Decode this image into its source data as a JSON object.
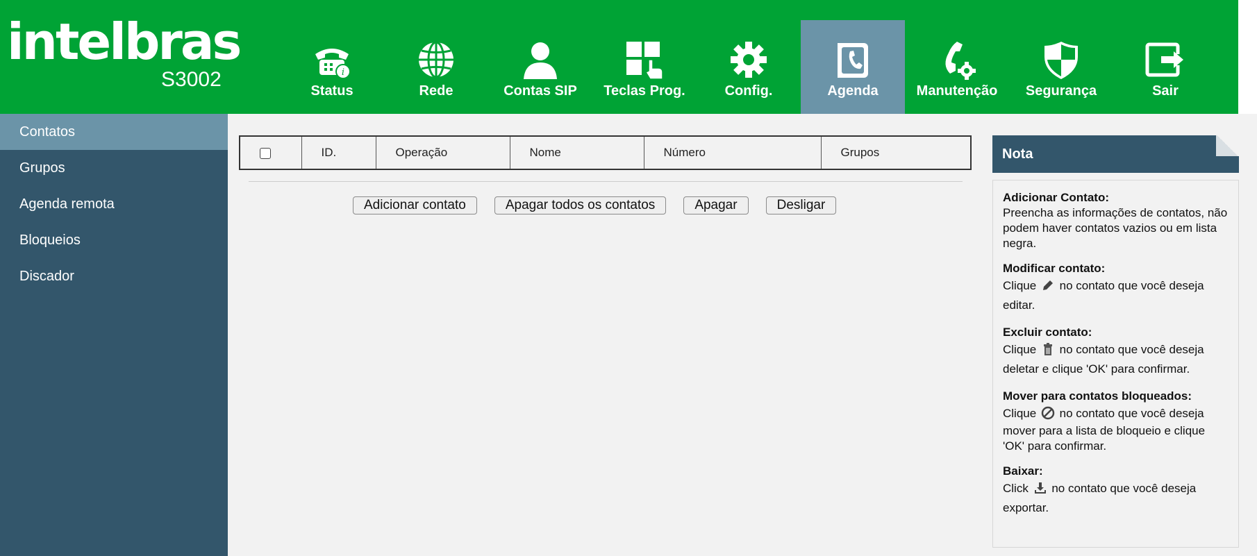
{
  "header": {
    "brand": "intelbras",
    "model": "S3002",
    "nav": [
      {
        "label": "Status",
        "icon": "phone-info-icon",
        "active": false
      },
      {
        "label": "Rede",
        "icon": "globe-icon",
        "active": false
      },
      {
        "label": "Contas SIP",
        "icon": "user-icon",
        "active": false
      },
      {
        "label": "Teclas Prog.",
        "icon": "keys-icon",
        "active": false
      },
      {
        "label": "Config.",
        "icon": "gear-icon",
        "active": false
      },
      {
        "label": "Agenda",
        "icon": "phonebook-icon",
        "active": true
      },
      {
        "label": "Manutenção",
        "icon": "phone-gear-icon",
        "active": false
      },
      {
        "label": "Segurança",
        "icon": "shield-icon",
        "active": false
      },
      {
        "label": "Sair",
        "icon": "exit-icon",
        "active": false
      }
    ]
  },
  "sidebar": {
    "items": [
      {
        "label": "Contatos",
        "active": true
      },
      {
        "label": "Grupos",
        "active": false
      },
      {
        "label": "Agenda remota",
        "active": false
      },
      {
        "label": "Bloqueios",
        "active": false
      },
      {
        "label": "Discador",
        "active": false
      }
    ]
  },
  "table": {
    "columns": [
      "ID.",
      "Operação",
      "Nome",
      "Número",
      "Grupos"
    ]
  },
  "buttons": {
    "add": "Adicionar contato",
    "delete_all": "Apagar todos os contatos",
    "delete": "Apagar",
    "hangup": "Desligar"
  },
  "note": {
    "title": "Nota",
    "add_title": "Adicionar Contato:",
    "add_text": "Preencha as informações de contatos, não podem haver contatos vazios ou em lista negra.",
    "modify_title": "Modificar contato:",
    "modify_pre": "Clique",
    "modify_post": "no contato que você deseja",
    "modify_end": "editar.",
    "delete_title": "Excluir contato:",
    "delete_pre": "Clique",
    "delete_post": "no contato que você deseja",
    "delete_end": "deletar e clique 'OK' para confirmar.",
    "block_title": "Mover para contatos bloqueados:",
    "block_pre": "Clique",
    "block_post": "no contato que você deseja",
    "block_end": "mover para a lista de bloqueio e clique 'OK' para confirmar.",
    "download_title": "Baixar:",
    "download_pre": "Click",
    "download_post": "no contato que você deseja",
    "download_end": "exportar."
  },
  "colors": {
    "header_green": "#00a335",
    "nav_active": "#6b94a8",
    "sidebar": "#33566b",
    "content_bg": "#f2f2f2"
  }
}
